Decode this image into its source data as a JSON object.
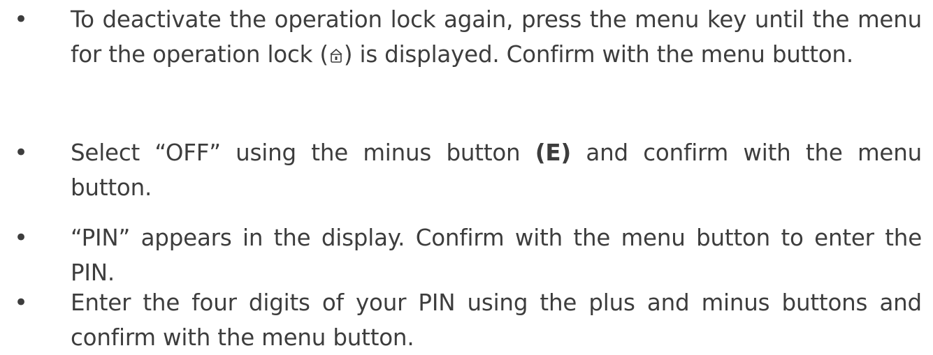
{
  "items": [
    {
      "line1": "To deactivate the operation lock again, press the menu key until the menu for the operation lock (",
      "icon": "lock-icon",
      "line2": ") is displayed. Confirm with the menu button."
    },
    {
      "part1": "Select “OFF” using the minus button ",
      "bold": "(E)",
      "part2": " and confirm with the menu button."
    },
    {
      "text": "“PIN” appears in the display. Confirm with the menu button to enter the PIN."
    },
    {
      "text": "Enter the four digits of your PIN using the plus and minus buttons and confirm with the menu button."
    }
  ]
}
